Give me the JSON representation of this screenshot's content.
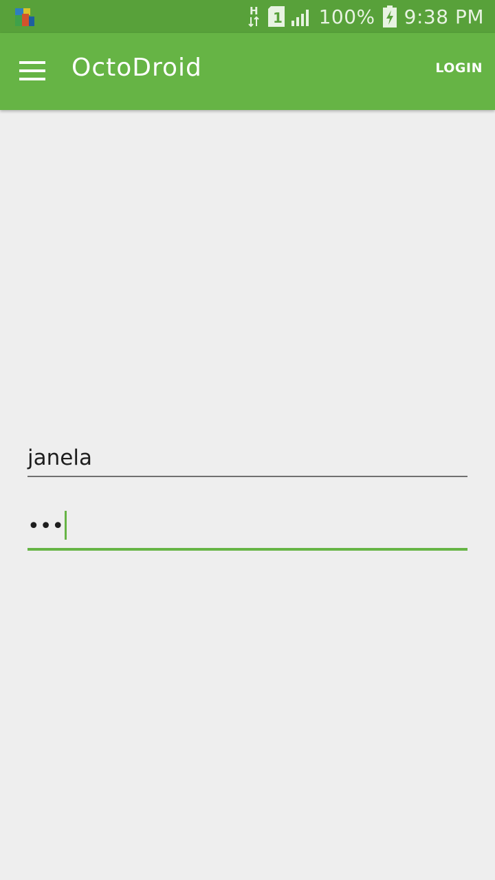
{
  "status_bar": {
    "network": "H",
    "sim_slot": "1",
    "battery_percent": "100%",
    "time": "9:38 PM",
    "icons": [
      "app-notification-icon",
      "data-transfer-icon",
      "sim-icon",
      "signal-icon",
      "battery-charging-icon"
    ]
  },
  "app_bar": {
    "title": "OctoDroid",
    "action_label": "LOGIN",
    "menu_icon": "hamburger-menu-icon",
    "color": "#66b445"
  },
  "form": {
    "username_value": "janela",
    "password_value": "•••"
  },
  "colors": {
    "accent": "#66b445",
    "status_bar": "#58a13a",
    "background": "#eeeeee"
  }
}
